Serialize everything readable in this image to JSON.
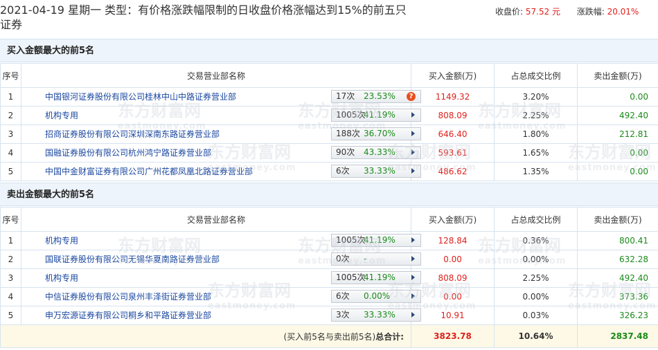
{
  "header": {
    "title": "2021-04-19 星期一  类型：有价格涨跌幅限制的日收盘价格涨幅达到15%的前五只证券",
    "close_label": "收盘价:",
    "close_value": "57.52 元",
    "change_label": "涨跌幅:",
    "change_value": "20.01%"
  },
  "buy_section": {
    "title": "买入金额最大的前5名",
    "columns": [
      "序号",
      "交易营业部名称",
      "买入金额(万)",
      "占总成交比例",
      "卖出金额(万)"
    ],
    "rows": [
      {
        "idx": "1",
        "name": "中国银河证券股份有限公司桂林中山中路证券营业部",
        "count": "17次",
        "pct": "23.53%",
        "icon": "question-icon",
        "buy": "1149.32",
        "ratio": "3.20%",
        "sell": "0.00"
      },
      {
        "idx": "2",
        "name": "机构专用",
        "count": "1005次",
        "pct": "41.19%",
        "icon": "arrow-right-icon",
        "buy": "808.09",
        "ratio": "2.25%",
        "sell": "492.40"
      },
      {
        "idx": "3",
        "name": "招商证券股份有限公司深圳深南东路证券营业部",
        "count": "188次",
        "pct": "36.70%",
        "icon": "arrow-right-icon",
        "buy": "646.40",
        "ratio": "1.80%",
        "sell": "212.81"
      },
      {
        "idx": "4",
        "name": "国融证券股份有限公司杭州鸿宁路证券营业部",
        "count": "90次",
        "pct": "43.33%",
        "icon": "arrow-right-icon",
        "buy": "593.61",
        "ratio": "1.65%",
        "sell": "0.00"
      },
      {
        "idx": "5",
        "name": "中国中金财富证券有限公司广州花都凤凰北路证券营业部",
        "count": "6次",
        "pct": "33.33%",
        "icon": "arrow-right-icon",
        "buy": "486.62",
        "ratio": "1.35%",
        "sell": "0.00"
      }
    ]
  },
  "sell_section": {
    "title": "卖出金额最大的前5名",
    "columns": [
      "序号",
      "交易营业部名称",
      "买入金额(万)",
      "占总成交比例",
      "卖出金额(万)"
    ],
    "rows": [
      {
        "idx": "1",
        "name": "机构专用",
        "count": "1005次",
        "pct": "41.19%",
        "icon": "arrow-right-icon",
        "buy": "128.84",
        "ratio": "0.36%",
        "sell": "800.41"
      },
      {
        "idx": "2",
        "name": "国联证券股份有限公司无锡华夏南路证券营业部",
        "count": "0次",
        "pct": "-",
        "icon": "arrow-right-icon",
        "buy": "0.00",
        "ratio": "0.00%",
        "sell": "632.28"
      },
      {
        "idx": "3",
        "name": "机构专用",
        "count": "1005次",
        "pct": "41.19%",
        "icon": "arrow-right-icon",
        "buy": "808.09",
        "ratio": "2.25%",
        "sell": "492.40"
      },
      {
        "idx": "4",
        "name": "中信证券股份有限公司泉州丰泽街证券营业部",
        "count": "6次",
        "pct": "0.00%",
        "icon": "arrow-right-icon",
        "buy": "0.00",
        "ratio": "0.00%",
        "sell": "373.36"
      },
      {
        "idx": "5",
        "name": "申万宏源证券有限公司桐乡和平路证券营业部",
        "count": "3次",
        "pct": "33.33%",
        "icon": "arrow-right-icon",
        "buy": "10.91",
        "ratio": "0.03%",
        "sell": "326.23"
      }
    ]
  },
  "total": {
    "label_prefix": "(买入前5名与卖出前5名)",
    "label_bold": "总合计:",
    "buy": "3823.78",
    "ratio": "10.64%",
    "sell": "2837.48"
  },
  "watermark": {
    "text": "东方财富网",
    "sub": "eastmoney.com"
  },
  "colors": {
    "red": "#e0211c",
    "green": "#1a8a1a",
    "link": "#1a47a0",
    "section_bg": "#eef4fb",
    "total_bg": "#fdf9e6"
  }
}
